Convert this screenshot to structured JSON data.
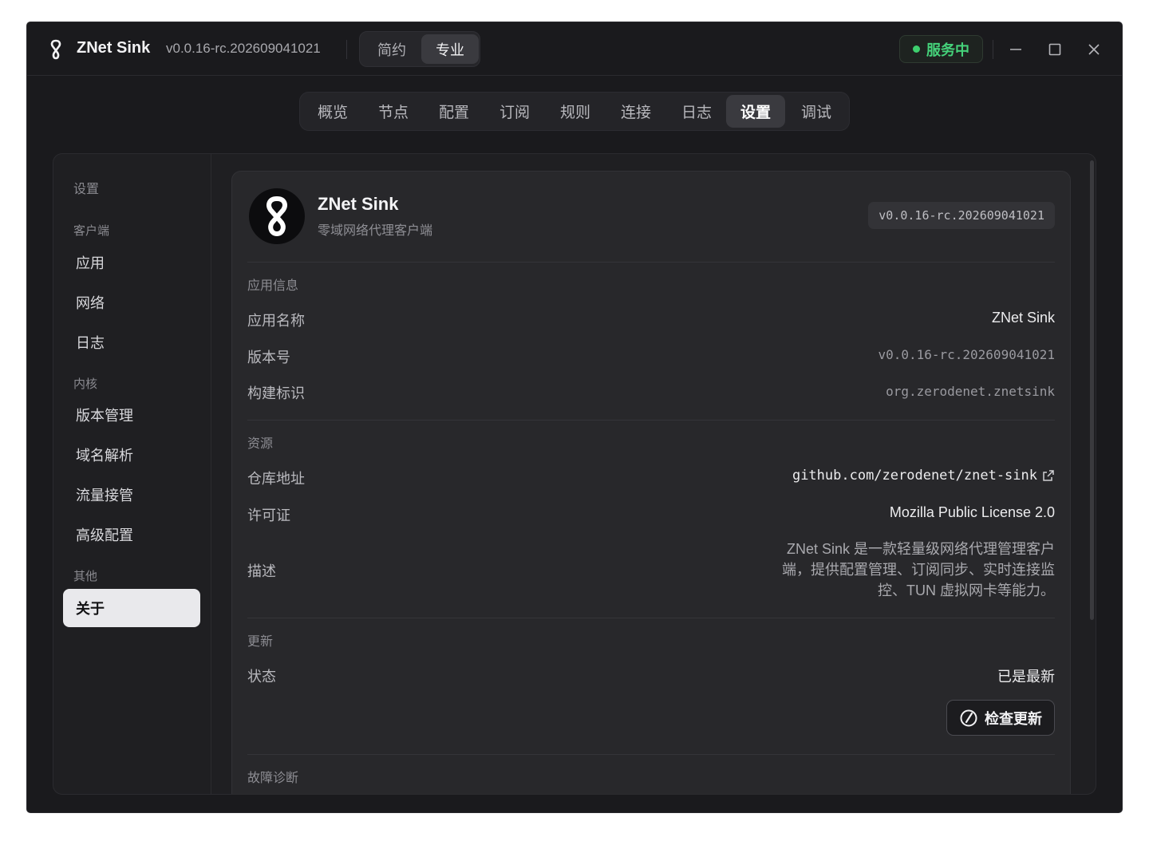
{
  "titlebar": {
    "app_name": "ZNet Sink",
    "version": "v0.0.16-rc.202609041021",
    "mode_simple": "简约",
    "mode_pro": "专业",
    "status": "服务中"
  },
  "tabs": [
    "概览",
    "节点",
    "配置",
    "订阅",
    "规则",
    "连接",
    "日志",
    "设置",
    "调试"
  ],
  "active_tab": "设置",
  "sidebar": {
    "title": "设置",
    "group_client": "客户端",
    "item_app": "应用",
    "item_network": "网络",
    "item_log": "日志",
    "group_core": "内核",
    "item_version": "版本管理",
    "item_dns": "域名解析",
    "item_traffic": "流量接管",
    "item_advanced": "高级配置",
    "group_other": "其他",
    "item_about": "关于"
  },
  "about": {
    "name": "ZNet Sink",
    "subtitle": "零域网络代理客户端",
    "version_badge": "v0.0.16-rc.202609041021",
    "section_info": "应用信息",
    "label_name": "应用名称",
    "value_name": "ZNet Sink",
    "label_version": "版本号",
    "value_version": "v0.0.16-rc.202609041021",
    "label_build": "构建标识",
    "value_build": "org.zerodenet.znetsink",
    "section_resources": "资源",
    "label_repo": "仓库地址",
    "value_repo": "github.com/zerodenet/znet-sink",
    "label_license": "许可证",
    "value_license": "Mozilla Public License 2.0",
    "label_desc": "描述",
    "desc_line1": "ZNet Sink 是一款轻量级网络代理管理客户",
    "desc_line2": "端，提供配置管理、订阅同步、实时连接监",
    "desc_line3": "控、TUN 虚拟网卡等能力。",
    "section_update": "更新",
    "label_status": "状态",
    "value_status": "已是最新",
    "check_button": "检查更新",
    "section_diag": "故障诊断"
  },
  "colors": {
    "background": "#1a1a1d",
    "status_green": "#45d27a",
    "active_sidebar": "#e9e9ec"
  }
}
